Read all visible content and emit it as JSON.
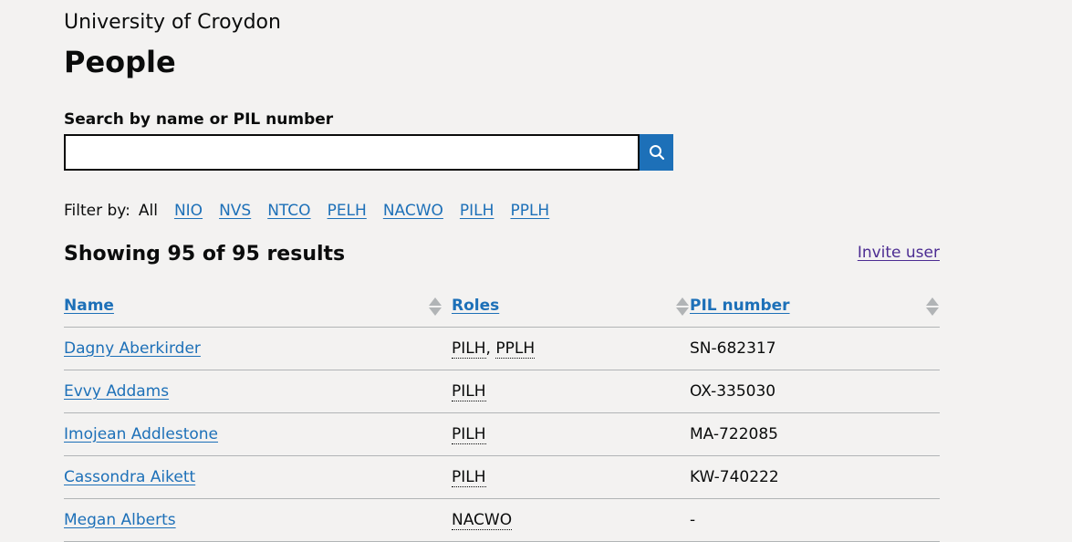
{
  "establishment": "University of Croydon",
  "page_title": "People",
  "search": {
    "label": "Search by name or PIL number",
    "value": "",
    "button_icon": "search-icon"
  },
  "filters": {
    "label": "Filter by:",
    "current": "All",
    "options": [
      "NIO",
      "NVS",
      "NTCO",
      "PELH",
      "NACWO",
      "PILH",
      "PPLH"
    ]
  },
  "results": {
    "summary": "Showing 95 of 95 results",
    "invite_label": "Invite user"
  },
  "table": {
    "headers": {
      "name": "Name",
      "roles": "Roles",
      "pil": "PIL number"
    },
    "rows": [
      {
        "name": "Dagny Aberkirder",
        "roles": [
          "PILH",
          "PPLH"
        ],
        "pil": "SN-682317"
      },
      {
        "name": "Evvy Addams",
        "roles": [
          "PILH"
        ],
        "pil": "OX-335030"
      },
      {
        "name": "Imojean Addlestone",
        "roles": [
          "PILH"
        ],
        "pil": "MA-722085"
      },
      {
        "name": "Cassondra Aikett",
        "roles": [
          "PILH"
        ],
        "pil": "KW-740222"
      },
      {
        "name": "Megan Alberts",
        "roles": [
          "NACWO"
        ],
        "pil": "-"
      }
    ],
    "role_separator": ", "
  },
  "colors": {
    "background": "#f3f2f1",
    "link": "#1d70b8",
    "visited_link": "#4c2c92",
    "text": "#0b0c0c",
    "border": "#b1b4b6"
  }
}
